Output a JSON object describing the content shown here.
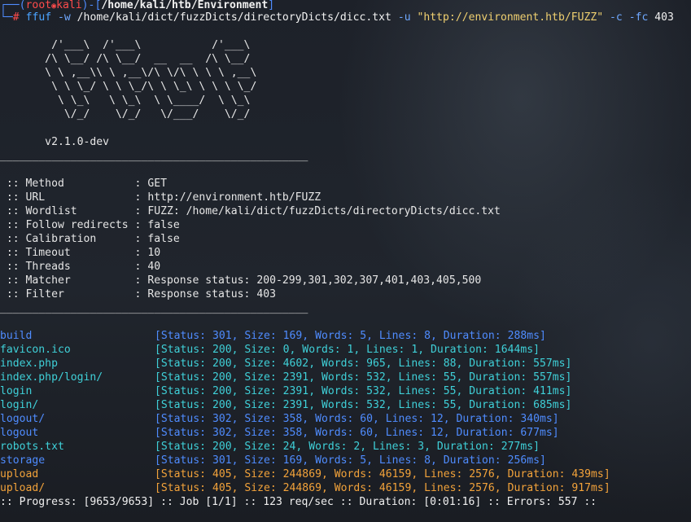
{
  "prompt": {
    "corner_top": "┌──(",
    "user": "root",
    "skull": "💀",
    "host": "kali",
    "sep": ")-[",
    "path": "/home/kali/htb/Environment",
    "close": "]",
    "corner_bottom": "└─",
    "hash": "#",
    "command": {
      "bin": "ffuf",
      "flag_w": "-w",
      "wordlist": "/home/kali/dict/fuzzDicts/directoryDicts/dicc.txt",
      "flag_u": "-u",
      "url": "\"http://environment.htb/FUZZ\"",
      "flag_c": "-c",
      "flag_fc": "-fc",
      "fc_value": "403"
    }
  },
  "banner": [
    "        /'___\\  /'___\\           /'___\\",
    "       /\\ \\__/ /\\ \\__/  __  __  /\\ \\__/",
    "       \\ \\ ,__\\\\ \\ ,__\\/\\ \\/\\ \\ \\ \\ ,__\\",
    "        \\ \\ \\_/ \\ \\ \\_/\\ \\ \\_\\ \\ \\ \\ \\_/",
    "         \\ \\_\\   \\ \\_\\  \\ \\____/  \\ \\_\\",
    "          \\/_/    \\/_/   \\/___/    \\/_/"
  ],
  "version": "       v2.1.0-dev",
  "separator": "________________________________________________",
  "config": [
    {
      "key": " :: Method           ",
      "value": ": GET"
    },
    {
      "key": " :: URL              ",
      "value": ": http://environment.htb/FUZZ"
    },
    {
      "key": " :: Wordlist         ",
      "value": ": FUZZ: /home/kali/dict/fuzzDicts/directoryDicts/dicc.txt"
    },
    {
      "key": " :: Follow redirects ",
      "value": ": false"
    },
    {
      "key": " :: Calibration      ",
      "value": ": false"
    },
    {
      "key": " :: Timeout          ",
      "value": ": 10"
    },
    {
      "key": " :: Threads          ",
      "value": ": 40"
    },
    {
      "key": " :: Matcher          ",
      "value": ": Response status: 200-299,301,302,307,401,403,405,500"
    },
    {
      "key": " :: Filter           ",
      "value": ": Response status: 403"
    }
  ],
  "results": [
    {
      "path": "build",
      "info": "[Status: 301, Size: 169, Words: 5, Lines: 8, Duration: 288ms]",
      "code": "301"
    },
    {
      "path": "favicon.ico",
      "info": "[Status: 200, Size: 0, Words: 1, Lines: 1, Duration: 1644ms]",
      "code": "200"
    },
    {
      "path": "index.php",
      "info": "[Status: 200, Size: 4602, Words: 965, Lines: 88, Duration: 557ms]",
      "code": "200"
    },
    {
      "path": "index.php/login/",
      "info": "[Status: 200, Size: 2391, Words: 532, Lines: 55, Duration: 557ms]",
      "code": "200"
    },
    {
      "path": "login",
      "info": "[Status: 200, Size: 2391, Words: 532, Lines: 55, Duration: 411ms]",
      "code": "200"
    },
    {
      "path": "login/",
      "info": "[Status: 200, Size: 2391, Words: 532, Lines: 55, Duration: 685ms]",
      "code": "200"
    },
    {
      "path": "logout/",
      "info": "[Status: 302, Size: 358, Words: 60, Lines: 12, Duration: 340ms]",
      "code": "302"
    },
    {
      "path": "logout",
      "info": "[Status: 302, Size: 358, Words: 60, Lines: 12, Duration: 677ms]",
      "code": "302"
    },
    {
      "path": "robots.txt",
      "info": "[Status: 200, Size: 24, Words: 2, Lines: 3, Duration: 277ms]",
      "code": "200"
    },
    {
      "path": "storage",
      "info": "[Status: 301, Size: 169, Words: 5, Lines: 8, Duration: 256ms]",
      "code": "301"
    },
    {
      "path": "upload",
      "info": "[Status: 405, Size: 244869, Words: 46159, Lines: 2576, Duration: 439ms]",
      "code": "405"
    },
    {
      "path": "upload/",
      "info": "[Status: 405, Size: 244869, Words: 46159, Lines: 2576, Duration: 917ms]",
      "code": "405"
    }
  ],
  "progress": ":: Progress: [9653/9653] :: Job [1/1] :: 123 req/sec :: Duration: [0:01:16] :: Errors: 557 ::",
  "colors": {
    "prompt": "#4f8cff",
    "user": "#ff4b4b",
    "status_3xx": "#4f8cff",
    "status_200": "#3fd0d8",
    "status_405": "#f2a23a",
    "background": "#1b1f27"
  }
}
